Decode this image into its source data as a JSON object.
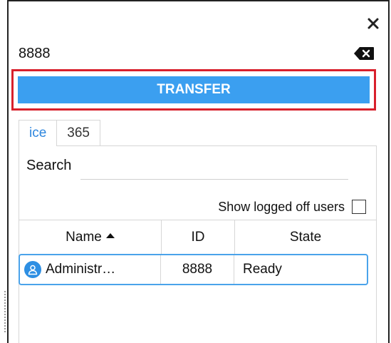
{
  "dialer": {
    "number_value": "8888",
    "transfer_label": "TRANSFER"
  },
  "tabs": [
    {
      "label": "ice",
      "active": true
    },
    {
      "label": "365",
      "active": false
    }
  ],
  "search": {
    "label": "Search",
    "placeholder": ""
  },
  "filters": {
    "show_logged_off_label": "Show logged off users",
    "show_logged_off_checked": false
  },
  "table": {
    "columns": {
      "name": "Name",
      "id": "ID",
      "state": "State"
    },
    "sort_column": "name",
    "sort_direction": "ascending",
    "rows": [
      {
        "name": "Administr…",
        "id": "8888",
        "state": "Ready"
      }
    ]
  },
  "colors": {
    "accent": "#3b9ff0",
    "highlight_border": "#d8202c",
    "active_tab_text": "#2e86de",
    "row_border": "#4aa3ea"
  },
  "icons": {
    "close": "close-icon",
    "backspace": "backspace-icon",
    "sort": "sort-ascending-icon",
    "user": "user-avatar-icon"
  }
}
